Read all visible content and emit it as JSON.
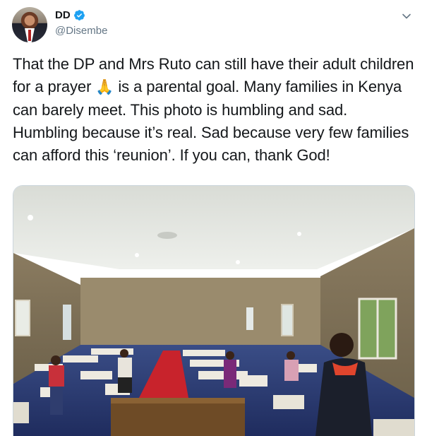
{
  "tweet": {
    "author_name": "DD",
    "author_handle": "@Disembe",
    "verified": true,
    "text_before_emoji": "That the DP and Mrs Ruto can still have their adult children for a prayer ",
    "emoji": "🙏",
    "text_after_emoji": " is a parental goal. Many families in Kenya can barely meet. This photo is humbling and sad. Humbling because it’s real. Sad because very few families can afford this ‘reunion’. If you can, thank God!",
    "photo_description_icon": "church-interior-photo"
  },
  "colors": {
    "verified_blue": "#1da1f2",
    "handle_gray": "#657786",
    "text": "#14171a"
  }
}
